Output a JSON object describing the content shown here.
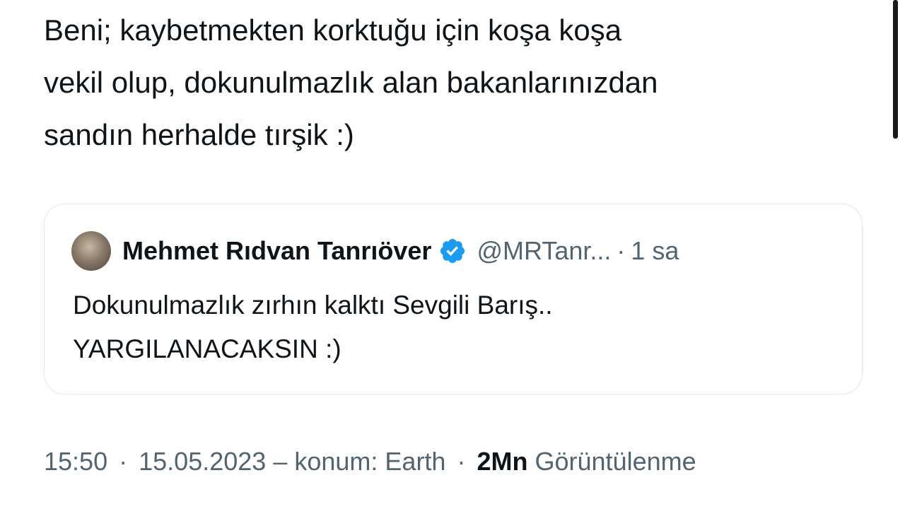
{
  "tweet": {
    "lines": [
      "Beni; kaybetmekten korktuğu için koşa koşa",
      "vekil olup, dokunulmazlık alan bakanlarınızdan",
      "sandın herhalde tırşik :)"
    ]
  },
  "quote": {
    "author_name": "Mehmet Rıdvan Tanrıöver",
    "handle": "@MRTanr...",
    "separator": "·",
    "time_ago": "1 sa",
    "lines": [
      "Dokunulmazlık zırhın kalktı Sevgili Barış..",
      "YARGILANACAKSIN :)"
    ],
    "verified_icon": "verified-badge-icon",
    "verified_color": "#1d9bf0"
  },
  "meta": {
    "time": "15:50",
    "sep1": "·",
    "date": "15.05.2023",
    "location": "– konum: Earth",
    "sep2": "·",
    "views_count": "2Mn",
    "views_label": "Görüntülenme"
  }
}
